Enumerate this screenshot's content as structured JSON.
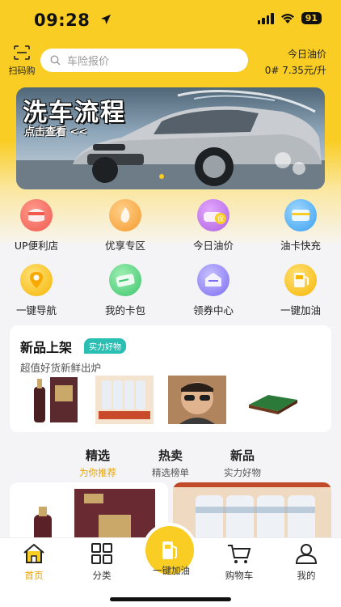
{
  "status": {
    "time": "09:28",
    "battery": "91"
  },
  "header": {
    "scan_label": "扫码购",
    "search_placeholder": "车险报价",
    "oil_title": "今日油价",
    "oil_value": "0# 7.35元/升"
  },
  "banner": {
    "title": "洗车流程",
    "subtitle": "点击查看 <<"
  },
  "grid": [
    {
      "label": "UP便利店",
      "icon": "store-icon",
      "color": "#f05a4f"
    },
    {
      "label": "优享专区",
      "icon": "vip-icon",
      "color": "#f59a2d"
    },
    {
      "label": "今日油价",
      "icon": "car-price-icon",
      "color": "#b060e0"
    },
    {
      "label": "油卡快充",
      "icon": "card-recharge-icon",
      "color": "#3aa0f0"
    },
    {
      "label": "一键导航",
      "icon": "location-pin-icon",
      "color": "#f5b500"
    },
    {
      "label": "我的卡包",
      "icon": "card-wallet-icon",
      "color": "#3cc46a"
    },
    {
      "label": "领券中心",
      "icon": "coupon-icon",
      "color": "#7a6cf0"
    },
    {
      "label": "一键加油",
      "icon": "fuel-icon",
      "color": "#f5b500"
    }
  ],
  "new_section": {
    "title": "新品上架",
    "tag": "实力好物",
    "subtitle": "超值好货新鲜出炉"
  },
  "tabs": [
    {
      "title": "精选",
      "sub": "为你推荐",
      "active": true
    },
    {
      "title": "热卖",
      "sub": "精选榜单",
      "active": false
    },
    {
      "title": "新品",
      "sub": "实力好物",
      "active": false
    }
  ],
  "nav": {
    "home": "首页",
    "category": "分类",
    "refuel": "一键加油",
    "cart": "购物车",
    "mine": "我的"
  },
  "colors": {
    "brand": "#f9cd24",
    "accent": "#e8a300"
  }
}
